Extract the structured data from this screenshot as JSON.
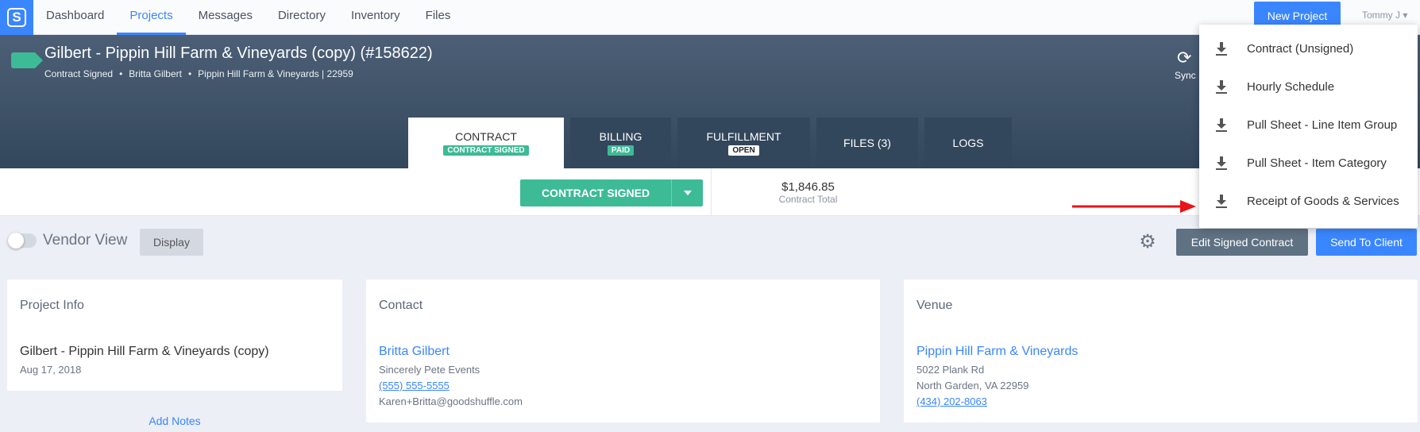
{
  "nav": {
    "items": [
      "Dashboard",
      "Projects",
      "Messages",
      "Directory",
      "Inventory",
      "Files"
    ],
    "active_index": 1,
    "new_project": "New Project",
    "user": "Tommy J"
  },
  "header": {
    "title": "Gilbert - Pippin Hill Farm & Vineyards (copy) (#158622)",
    "sub_items": [
      "Contract Signed",
      "Britta Gilbert",
      "Pippin Hill Farm & Vineyards | 22959"
    ],
    "sync_label": "Sync",
    "tabs": [
      {
        "label": "CONTRACT",
        "badge": "CONTRACT SIGNED"
      },
      {
        "label": "BILLING",
        "badge": "PAID"
      },
      {
        "label": "FULFILLMENT",
        "badge": "OPEN"
      },
      {
        "label": "FILES (3)",
        "badge": ""
      },
      {
        "label": "LOGS",
        "badge": ""
      }
    ]
  },
  "status": {
    "contract_button": "CONTRACT SIGNED",
    "total_amount": "$1,846.85",
    "total_label": "Contract Total"
  },
  "toolbar": {
    "vendor_view": "Vendor View",
    "display": "Display",
    "edit_signed": "Edit Signed Contract",
    "send_to_client": "Send To Client"
  },
  "cards": {
    "project": {
      "title": "Project Info",
      "name": "Gilbert - Pippin Hill Farm & Vineyards (copy)",
      "date": "Aug 17, 2018",
      "add_notes": "Add Notes"
    },
    "contact": {
      "title": "Contact",
      "name": "Britta Gilbert",
      "company": "Sincerely Pete Events",
      "phone": "(555) 555-5555",
      "email": "Karen+Britta@goodshuffle.com"
    },
    "venue": {
      "title": "Venue",
      "name": "Pippin Hill Farm & Vineyards",
      "address1": "5022 Plank Rd",
      "address2": "North Garden, VA 22959",
      "phone": "(434) 202-8063"
    }
  },
  "dropdown": {
    "items": [
      "Contract (Unsigned)",
      "Hourly Schedule",
      "Pull Sheet - Line Item Group",
      "Pull Sheet - Item Category",
      "Receipt of Goods & Services"
    ],
    "icon": "download-icon"
  },
  "colors": {
    "accent": "#3a86ff",
    "success": "#3dba96",
    "header_bg": "#3b4e64",
    "annotation_arrow": "#e8141a"
  }
}
